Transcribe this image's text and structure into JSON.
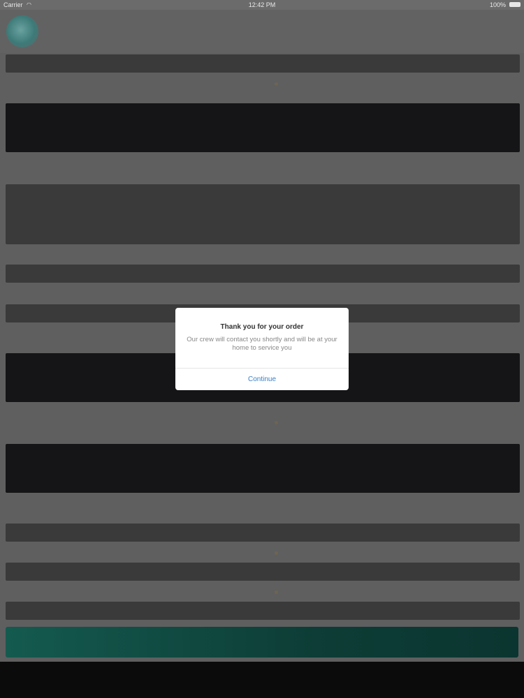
{
  "status_bar": {
    "carrier": "Carrier",
    "time": "12:42 PM",
    "battery": "100%"
  },
  "dialog": {
    "title": "Thank you for your order",
    "message": "Our crew will contact you shortly and will be at your home to service you",
    "continue_label": "Continue"
  },
  "colors": {
    "overlay": "#5f5f60",
    "dialog_bg": "#ffffff",
    "link": "#3a7fc4",
    "submit": "#145a4f"
  }
}
